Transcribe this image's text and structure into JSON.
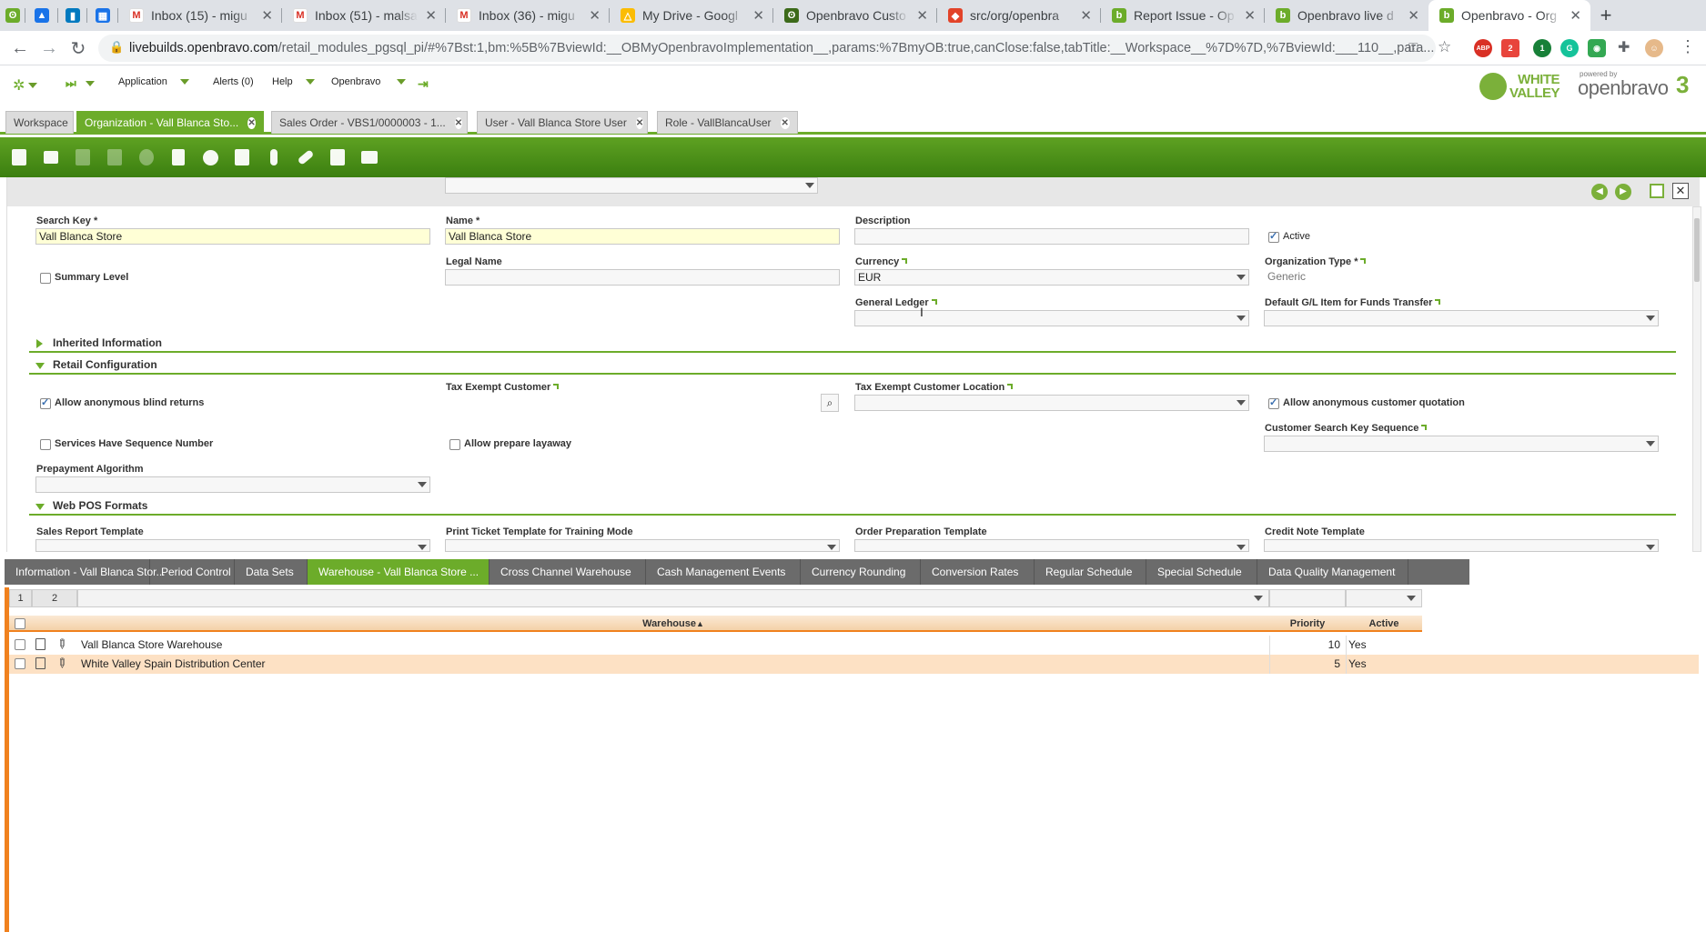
{
  "browser": {
    "tabs": [
      {
        "title": "",
        "icon": "openbravo-icon"
      },
      {
        "title": "",
        "icon": "drive-triangle-icon"
      },
      {
        "title": "",
        "icon": "trello-icon"
      },
      {
        "title": "",
        "icon": "calendar-icon"
      },
      {
        "title": "Inbox (15) - migu",
        "icon": "gmail-icon"
      },
      {
        "title": "Inbox (51) - malsa",
        "icon": "gmail-icon"
      },
      {
        "title": "Inbox (36) - migu",
        "icon": "gmail-icon"
      },
      {
        "title": "My Drive - Googl",
        "icon": "google-drive-icon"
      },
      {
        "title": "Openbravo Custo",
        "icon": "openbravo-icon"
      },
      {
        "title": "src/org/openbra",
        "icon": "gitlab-icon"
      },
      {
        "title": "Report Issue - Op",
        "icon": "openbravo-icon"
      },
      {
        "title": "Openbravo live d",
        "icon": "openbravo-icon"
      },
      {
        "title": "Openbravo - Org",
        "icon": "openbravo-icon"
      }
    ],
    "url_host": "livebuilds.openbravo.com",
    "url_path": "/retail_modules_pgsql_pi/#%7Bst:1,bm:%5B%7BviewId:__OBMyOpenbravoImplementation__,params:%7BmyOB:true,canClose:false,tabTitle:__Workspace__%7D%7D,%7BviewId:___110__,para..."
  },
  "menu": {
    "application": "Application",
    "alerts": "Alerts (0)",
    "help": "Help",
    "user": "Openbravo"
  },
  "logos": {
    "white_valley_1": "WHITE",
    "white_valley_2": "VALLEY",
    "powered_by": "powered by",
    "openbravo": "openbravo",
    "version": "3"
  },
  "view_tabs": [
    {
      "label": "Workspace"
    },
    {
      "label": "Organization - Vall Blanca Sto..."
    },
    {
      "label": "Sales Order - VBS1/0000003 - 1..."
    },
    {
      "label": "User - Vall Blanca Store User"
    },
    {
      "label": "Role - VallBlancaUser"
    }
  ],
  "form": {
    "search_key_label": "Search Key *",
    "search_key_value": "Vall Blanca Store",
    "name_label": "Name *",
    "name_value": "Vall Blanca Store",
    "description_label": "Description",
    "description_value": "",
    "active_label": "Active",
    "active_checked": true,
    "summary_level_label": "Summary Level",
    "summary_level_checked": false,
    "legal_name_label": "Legal Name",
    "currency_label": "Currency",
    "currency_value": "EUR",
    "org_type_label": "Organization Type *",
    "org_type_value": "Generic",
    "general_ledger_label": "General Ledger",
    "default_gl_label": "Default G/L Item for Funds Transfer",
    "inherited_section": "Inherited Information",
    "retail_section": "Retail Configuration",
    "allow_blind_returns_label": "Allow anonymous blind returns",
    "allow_blind_returns_checked": true,
    "tax_exempt_customer_label": "Tax Exempt Customer",
    "tax_exempt_location_label": "Tax Exempt Customer Location",
    "allow_quotation_label": "Allow anonymous customer quotation",
    "allow_quotation_checked": true,
    "services_seq_label": "Services Have Sequence Number",
    "services_seq_checked": false,
    "allow_layaway_label": "Allow prepare layaway",
    "allow_layaway_checked": false,
    "customer_seq_label": "Customer Search Key Sequence",
    "prepayment_label": "Prepayment Algorithm",
    "webpos_section": "Web POS Formats",
    "sales_report_label": "Sales Report Template",
    "print_ticket_label": "Print Ticket Template for Training Mode",
    "order_prep_label": "Order Preparation Template",
    "credit_note_label": "Credit Note Template"
  },
  "child_tabs": [
    {
      "label": "Information - Vall Blanca Stor..."
    },
    {
      "label": "Period Control"
    },
    {
      "label": "Data Sets"
    },
    {
      "label": "Warehouse - Vall Blanca Store ..."
    },
    {
      "label": "Cross Channel Warehouse"
    },
    {
      "label": "Cash Management Events"
    },
    {
      "label": "Currency Rounding"
    },
    {
      "label": "Conversion Rates"
    },
    {
      "label": "Regular Schedule"
    },
    {
      "label": "Special Schedule"
    },
    {
      "label": "Data Quality Management"
    }
  ],
  "grid": {
    "group_1": "1",
    "group_2": "2",
    "col_warehouse": "Warehouse",
    "col_priority": "Priority",
    "col_active": "Active",
    "rows": [
      {
        "warehouse": "Vall Blanca Store Warehouse",
        "priority": "10",
        "active": "Yes"
      },
      {
        "warehouse": "White Valley Spain Distribution Center",
        "priority": "5",
        "active": "Yes"
      }
    ]
  }
}
